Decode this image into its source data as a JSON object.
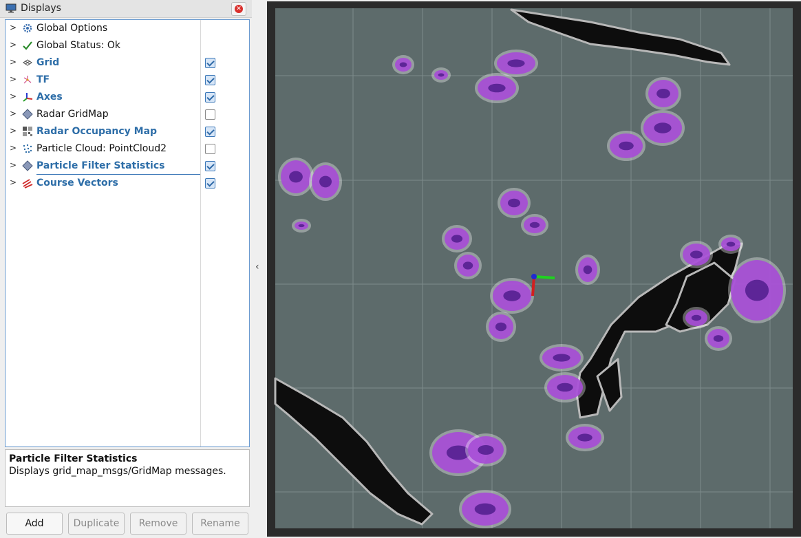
{
  "panel": {
    "title": "Displays",
    "close_icon": "close-icon"
  },
  "displays": [
    {
      "label": "Global Options",
      "icon": "gear-icon",
      "highlight": false,
      "checkbox": null
    },
    {
      "label": "Global Status: Ok",
      "icon": "checkmark-icon",
      "highlight": false,
      "checkbox": null
    },
    {
      "label": "Grid",
      "icon": "grid-icon",
      "highlight": true,
      "checkbox": true
    },
    {
      "label": "TF",
      "icon": "tf-icon",
      "highlight": true,
      "checkbox": true
    },
    {
      "label": "Axes",
      "icon": "axes-icon",
      "highlight": true,
      "checkbox": true
    },
    {
      "label": "Radar GridMap",
      "icon": "gridmap-icon",
      "highlight": false,
      "checkbox": false
    },
    {
      "label": "Radar Occupancy Map",
      "icon": "occupancy-map-icon",
      "highlight": true,
      "checkbox": true
    },
    {
      "label": "Particle Cloud: PointCloud2",
      "icon": "pointcloud-icon",
      "highlight": false,
      "checkbox": false
    },
    {
      "label": "Particle Filter Statistics",
      "icon": "gridmap-icon",
      "highlight": true,
      "checkbox": true
    },
    {
      "label": "Course Vectors",
      "icon": "arrows-icon",
      "highlight": true,
      "checkbox": true
    }
  ],
  "description": {
    "title": "Particle Filter Statistics",
    "text": "Displays grid_map_msgs/GridMap messages."
  },
  "buttons": {
    "add": "Add",
    "duplicate": "Duplicate",
    "remove": "Remove",
    "rename": "Rename"
  },
  "colors": {
    "map_background": "#5d6b6b",
    "map_border": "#2b2b2b",
    "obstacle": "#0d0d0d",
    "obstacle_edge": "#b8b8b8",
    "particle": "#a64dd6",
    "particle_core": "#4b1a88",
    "accent_blue": "#2e6ea8"
  }
}
